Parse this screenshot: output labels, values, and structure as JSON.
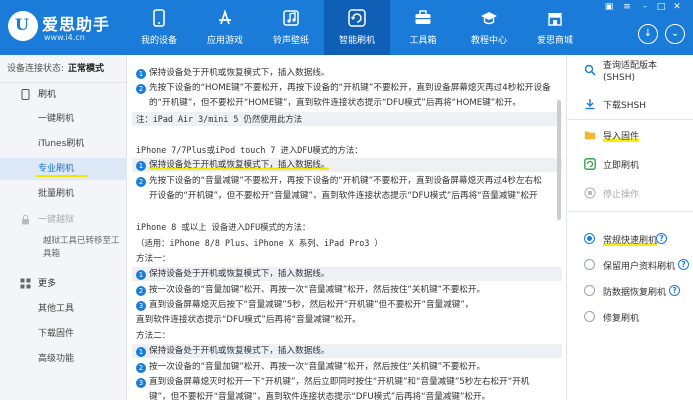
{
  "app": {
    "name": "爱思助手",
    "url": "www.i4.cn",
    "logo_mark": "U"
  },
  "nav": [
    {
      "label": "我的设备",
      "icon": "phone-icon"
    },
    {
      "label": "应用游戏",
      "icon": "app-store-icon"
    },
    {
      "label": "铃声壁纸",
      "icon": "music-icon"
    },
    {
      "label": "智能刷机",
      "icon": "refresh-icon",
      "active": true
    },
    {
      "label": "工具箱",
      "icon": "toolbox-icon"
    },
    {
      "label": "教程中心",
      "icon": "graduation-cap-icon"
    },
    {
      "label": "爱思商城",
      "icon": "store-icon"
    }
  ],
  "sidebar": {
    "status_label": "设备连接状态:",
    "status_value": "正常模式",
    "group_flash": "刷机",
    "items_flash": [
      "一键刷机",
      "iTunes刷机",
      "专业刷机",
      "批量刷机"
    ],
    "group_jailbreak": "一键越狱",
    "jailbreak_note": "越狱工具已转移至工具箱",
    "group_more": "更多",
    "items_more": [
      "其他工具",
      "下载固件",
      "高级功能"
    ]
  },
  "content": {
    "lines": [
      "保持设备处于开机或恢复模式下，插入数据线。",
      "先按下设备的“HOME键”不要松开，再按下设备的“开机键”不要松开，直到设备屏幕熄灭再过4秒松开设备",
      "的“开机键”，但不要松开“HOME键”，直到软件连接状态提示“DFU模式”后再将“HOME键”松开。",
      "注：iPad Air 3/mini 5 仍然使用此方法",
      "iPhone 7/7Plus或iPod touch 7 进入DFU模式的方法：",
      "保持设备处于开机或恢复模式下，插入数据线。",
      "先按下设备的“音量减键”不要松开，再按下设备的“开机键”不要松开，直到设备屏幕熄灭再过4秒左右松",
      "开设备的“开机键”，但不要松开“音量减键”，直到软件连接状态提示“DFU模式”后再将“音量减键”松开",
      "iPhone 8 或以上 设备进入DFU模式的方法：",
      "（适用：iPhone 8/8 Plus、iPhone X 系列、iPad Pro3 ）",
      "方法一：",
      "保持设备处于开机或恢复模式下，插入数据线。",
      "按一次设备的“音量加键”松开、再按一次“音量减键”松开，然后按住“关机键”不要松开。",
      "直到设备屏幕熄灭后按下“音量减键”5秒，然后松开“开机键”但不要松开“音量减键”，",
      "直到软件连接状态提示“DFU模式”后再将“音量减键”松开。",
      "方法二：",
      "保持设备处于开机或恢复模式下，插入数据线。",
      "按一次设备的“音量加键”松开、再按一次“音量减键”松开，然后按住“关机键”不要松开。",
      "直到设备屏幕熄灭时松开一下“开机键”，然后立即同时按住“开机键”和“音量减键”5秒左右松开“开机",
      "键”，但不要松开“音量减键”，直到软件连接状态提示“DFU模式”后再将“音量减键”松开。"
    ],
    "num1": "1",
    "num2": "2",
    "num3": "3"
  },
  "right_panel": {
    "query": "查询适配版本\n(SHSH)",
    "download_shsh": "下载SHSH",
    "import_firmware": "导入固件",
    "flash_now": "立即刷机",
    "stop": "停止操作",
    "options": [
      {
        "label": "常规快速刷机",
        "selected": true,
        "help": true
      },
      {
        "label": "保留用户资料刷机",
        "selected": false,
        "help": true
      },
      {
        "label": "防数据恢复刷机",
        "selected": false,
        "help": true
      },
      {
        "label": "修复刷机",
        "selected": false,
        "help": false
      }
    ],
    "help_glyph": "?"
  },
  "colors": {
    "brand": "#1a7bd8",
    "nav_active": "#0e5fb5",
    "highlight": "#f6ee00"
  }
}
